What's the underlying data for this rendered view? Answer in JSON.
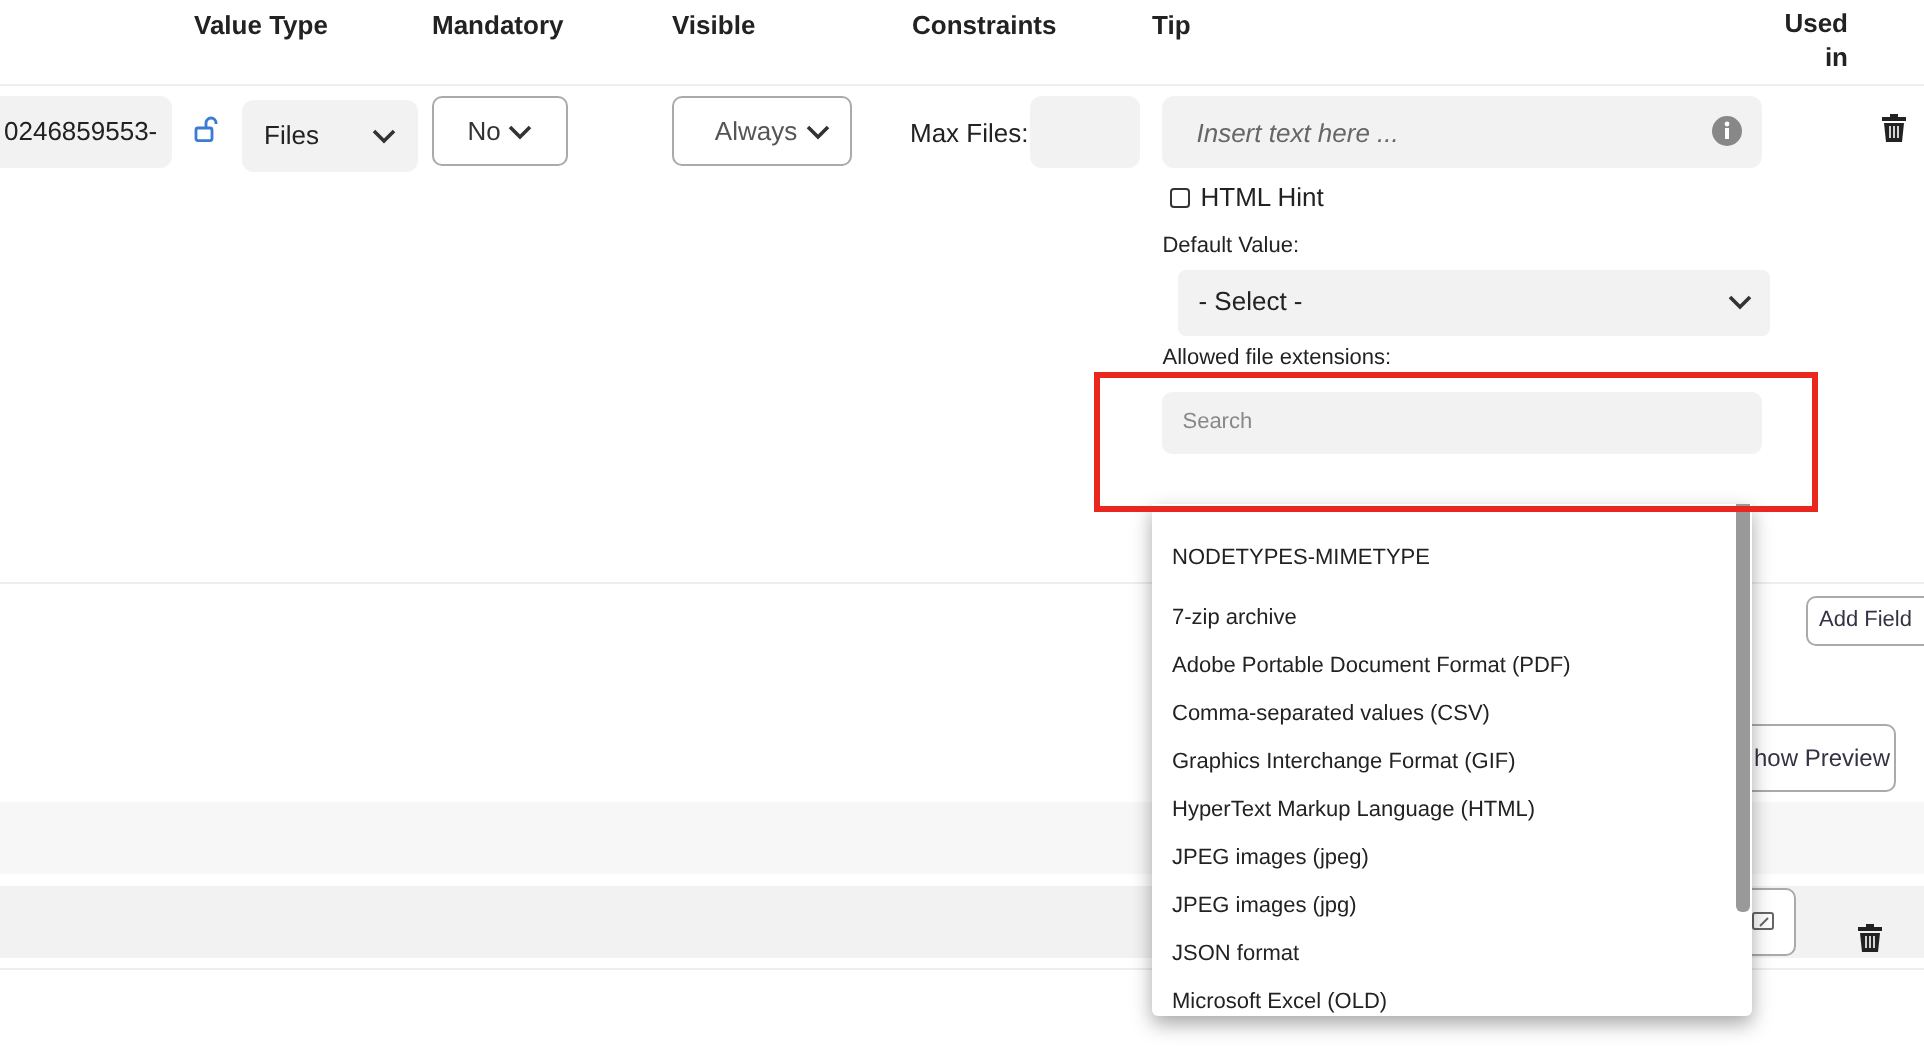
{
  "table": {
    "columns": [
      "Value Type",
      "Mandatory",
      "Visible",
      "Constraints",
      "Tip",
      "Used in"
    ],
    "row": {
      "id": "0246859553-",
      "value_type": "Files",
      "mandatory": "No",
      "visible": "Always",
      "constraint_label": "Max Files:",
      "tip": {
        "placeholder": "Insert text here ..."
      },
      "html_hint": {
        "label": "HTML Hint",
        "checked": false
      },
      "default_value_label": "Default Value:",
      "default_value": "- Select -",
      "extensions_label": "Allowed file extensions:",
      "extensions_search": {
        "placeholder": "Search"
      }
    }
  },
  "add_field_button": "Add Field",
  "preview_button": "how Preview",
  "dropdown": {
    "group": "NODETYPES-MIMETYPE",
    "options": [
      "7-zip archive",
      "Adobe Portable Document Format (PDF)",
      "Comma-separated values (CSV)",
      "Graphics Interchange Format (GIF)",
      "HyperText Markup Language (HTML)",
      "JPEG images (jpeg)",
      "JPEG images (jpg)",
      "JSON format",
      "Microsoft Excel (OLD)"
    ]
  }
}
